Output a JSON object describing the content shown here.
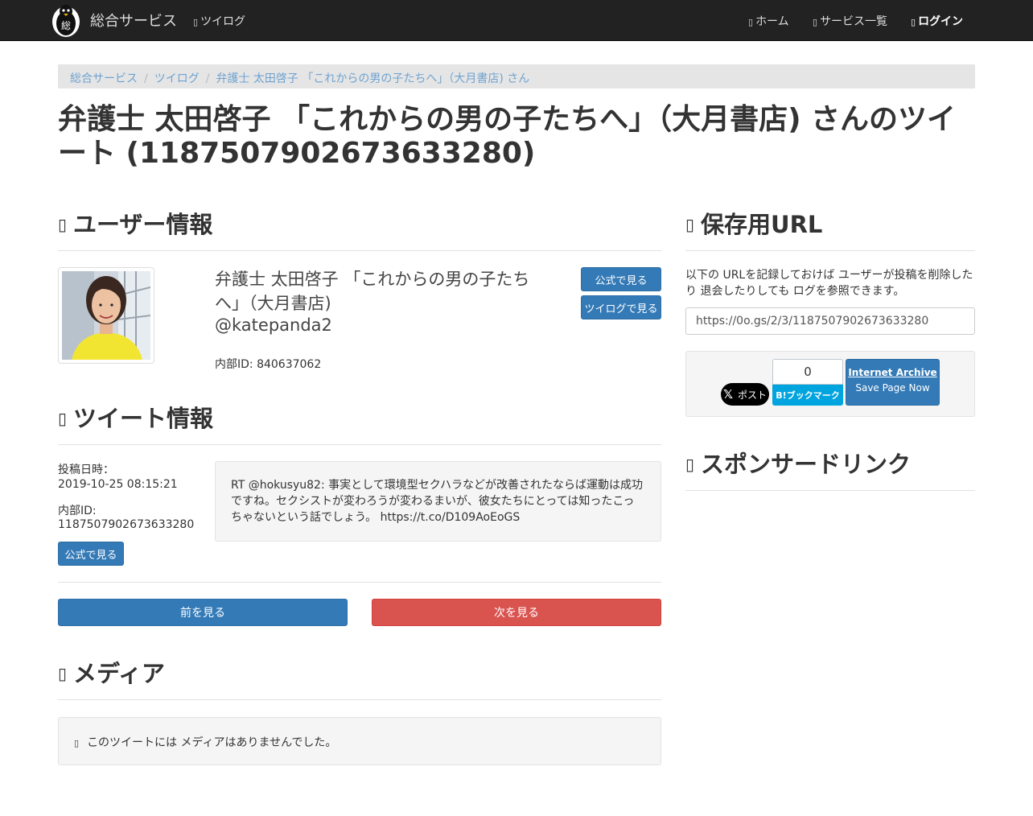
{
  "navbar": {
    "brand": "総合サービス",
    "logo_char": "総",
    "links": [
      {
        "label": "ツイログ",
        "icon": "list-icon"
      },
      {
        "label": "ホーム",
        "icon": "home-icon"
      },
      {
        "label": "サービス一覧",
        "icon": "th-list-icon"
      },
      {
        "label": "ログイン",
        "icon": "login-icon"
      }
    ]
  },
  "breadcrumb": [
    "総合サービス",
    "ツイログ",
    "弁護士 太田啓子 「これからの男の子たちへ」（大月書店) さん"
  ],
  "page_title": "弁護士 太田啓子 「これからの男の子たちへ」（大月書店) さんのツイート (1187507902673633280)",
  "user_section": {
    "heading": "ユーザー情報",
    "name": "弁護士 太田啓子 「これからの男の子たちへ」（大月書店)",
    "handle": "@katepanda2",
    "internal_id": "内部ID: 840637062",
    "official_button": "公式で見る",
    "twilog_button": "ツイログで見る"
  },
  "tweet_section": {
    "heading": "ツイート情報",
    "posted_label": "投稿日時：",
    "posted_value": "2019-10-25 08:15:21",
    "id_label": "内部ID:",
    "id_value": "1187507902673633280",
    "official_button": "公式で見る",
    "text": "RT @hokusyu82: 事実として環境型セクハラなどが改善されたならば運動は成功ですね。セクシストが変わろうが変わるまいが、彼女たちにとっては知ったこっちゃないという話でしょう。 https://t.co/D109AoEoGS"
  },
  "pager": {
    "prev": "前を見る",
    "next": "次を見る"
  },
  "media_section": {
    "heading": "メディア",
    "empty_text": "このツイートには メディアはありませんでした。"
  },
  "archive_section": {
    "heading": "保存用URL",
    "description": "以下の URLを記録しておけば ユーザーが投稿を削除したり 退会したりしても ログを参照できます。",
    "url": "https://0o.gs/2/3/1187507902673633280",
    "x_label": "ポスト",
    "hatena_count": "0",
    "hatena_label": "B!ブックマーク",
    "ia_title": "Internet Archive",
    "ia_sub": "Save Page Now"
  },
  "sponsor_section": {
    "heading": "スポンサードリンク"
  },
  "colors": {
    "primary": "#337ab7",
    "danger": "#d9534f",
    "navbar": "#222222",
    "hatena": "#00a4de"
  }
}
